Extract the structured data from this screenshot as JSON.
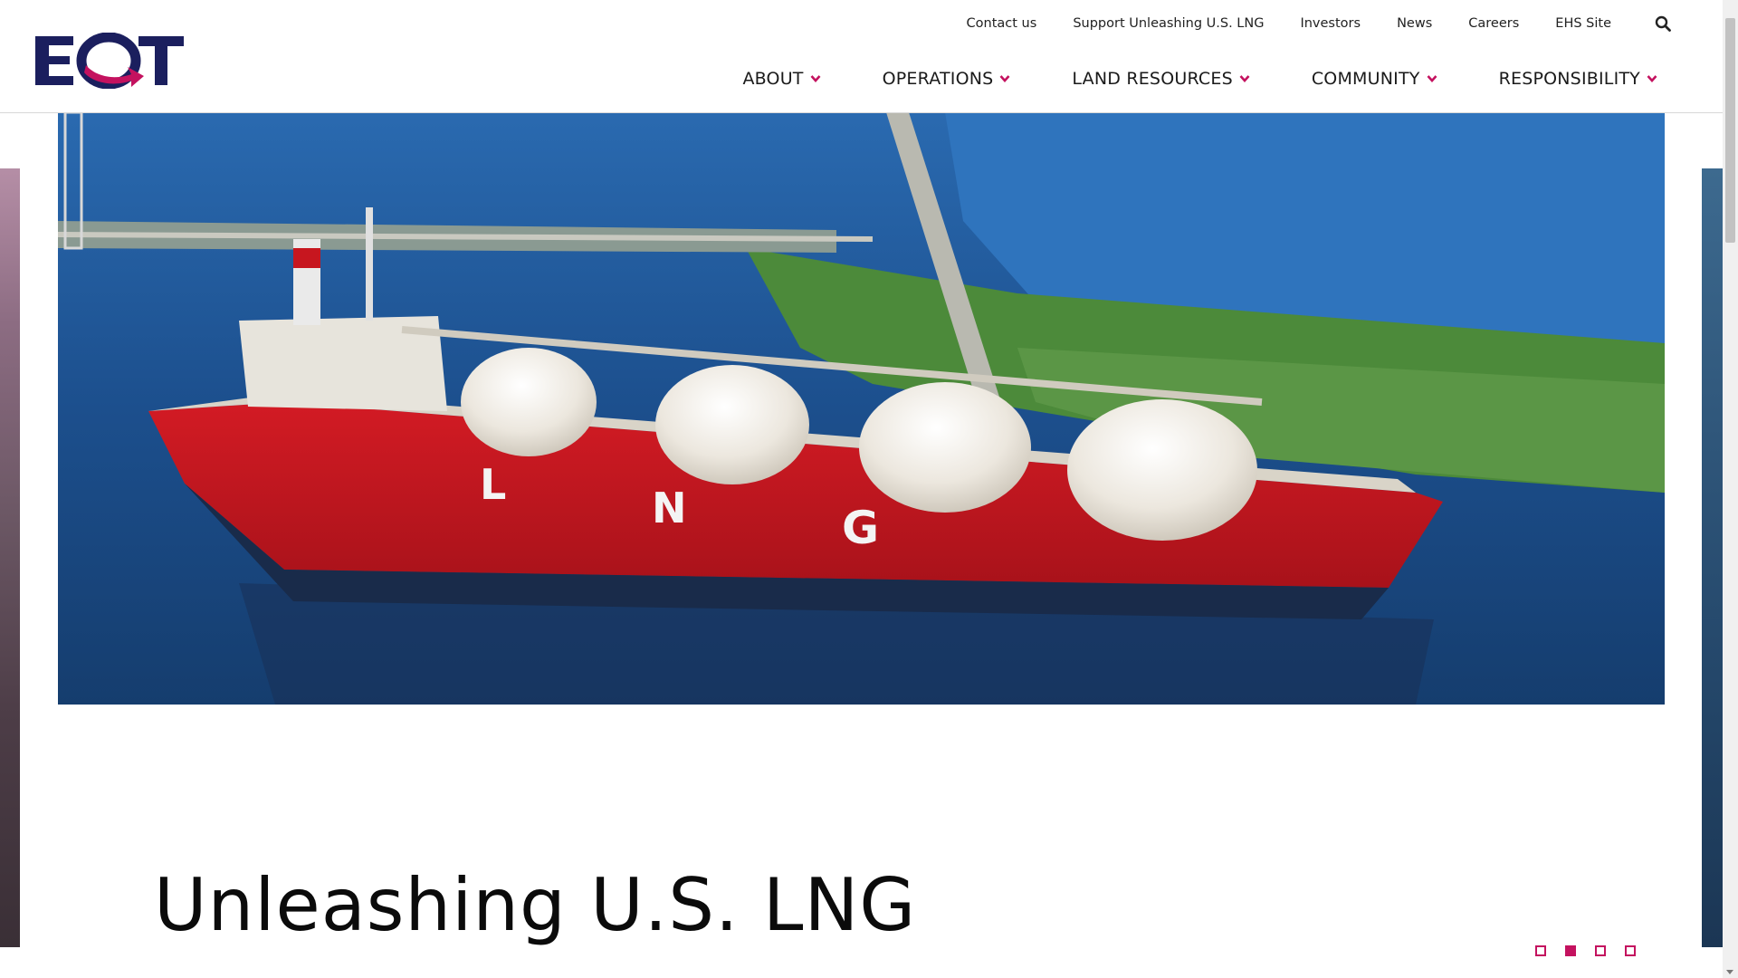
{
  "brand": {
    "logo_text": "EQT",
    "accent": "#c4125f",
    "navy": "#1b1f5e"
  },
  "utility_nav": [
    "Contact us",
    "Support Unleashing U.S. LNG",
    "Investors",
    "News",
    "Careers",
    "EHS Site"
  ],
  "main_nav": [
    "ABOUT",
    "OPERATIONS",
    "LAND RESOURCES",
    "COMMUNITY",
    "RESPONSIBILITY"
  ],
  "icons": {
    "search": "search-icon",
    "chevron": "chevron-down-icon"
  },
  "hero": {
    "ship_letters": [
      "L",
      "N",
      "G"
    ],
    "title": "Unleashing U.S. LNG"
  },
  "carousel": {
    "slides": 4,
    "active": 2
  }
}
